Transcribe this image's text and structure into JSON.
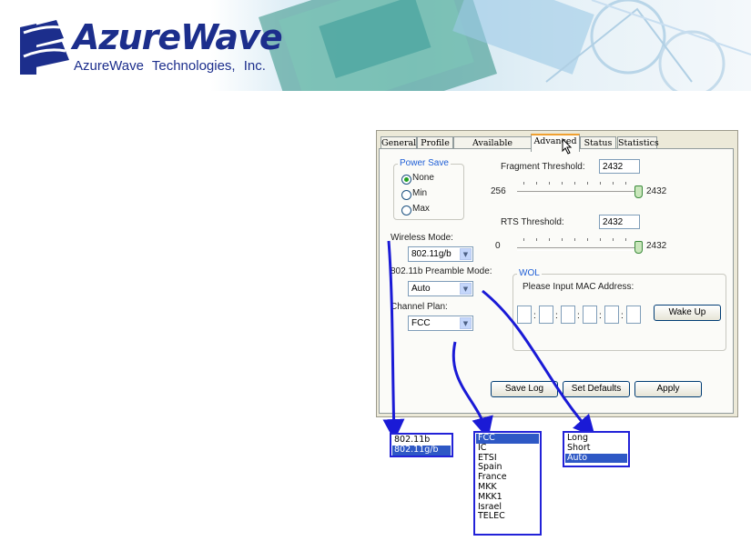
{
  "banner": {
    "brand": "AzureWave",
    "company": "AzureWave Technologies, Inc.",
    "colors": {
      "brand": "#1c2e8c",
      "accent": "#1f5fd6"
    }
  },
  "tabs": [
    {
      "label": "General"
    },
    {
      "label": "Profile"
    },
    {
      "label": "Available Network"
    },
    {
      "label": "Advanced",
      "active": true
    },
    {
      "label": "Status"
    },
    {
      "label": "Statistics"
    }
  ],
  "power_save": {
    "legend": "Power Save",
    "options": [
      {
        "label": "None",
        "selected": true
      },
      {
        "label": "Min",
        "selected": false
      },
      {
        "label": "Max",
        "selected": false
      }
    ]
  },
  "fragment": {
    "label": "Fragment Threshold:",
    "value": "2432",
    "min": "256",
    "max": "2432"
  },
  "rts": {
    "label": "RTS Threshold:",
    "value": "2432",
    "min": "0",
    "max": "2432"
  },
  "wireless_mode": {
    "label": "Wireless Mode:",
    "value": "802.11g/b",
    "options": [
      "802.11b",
      "802.11g/b"
    ]
  },
  "preamble": {
    "label": "802.11b Preamble Mode:",
    "value": "Auto",
    "options": [
      "Long",
      "Short",
      "Auto"
    ]
  },
  "channel_plan": {
    "label": "Channel Plan:",
    "value": "FCC",
    "options": [
      "FCC",
      "IC",
      "ETSI",
      "Spain",
      "France",
      "MKK",
      "MKK1",
      "Israel",
      "TELEC"
    ]
  },
  "wol": {
    "legend": "WOL",
    "prompt": "Please Input MAC Address:",
    "wake_label": "Wake Up",
    "separator": ":"
  },
  "buttons": {
    "save_log": "Save Log",
    "set_defaults": "Set Defaults",
    "apply": "Apply"
  }
}
